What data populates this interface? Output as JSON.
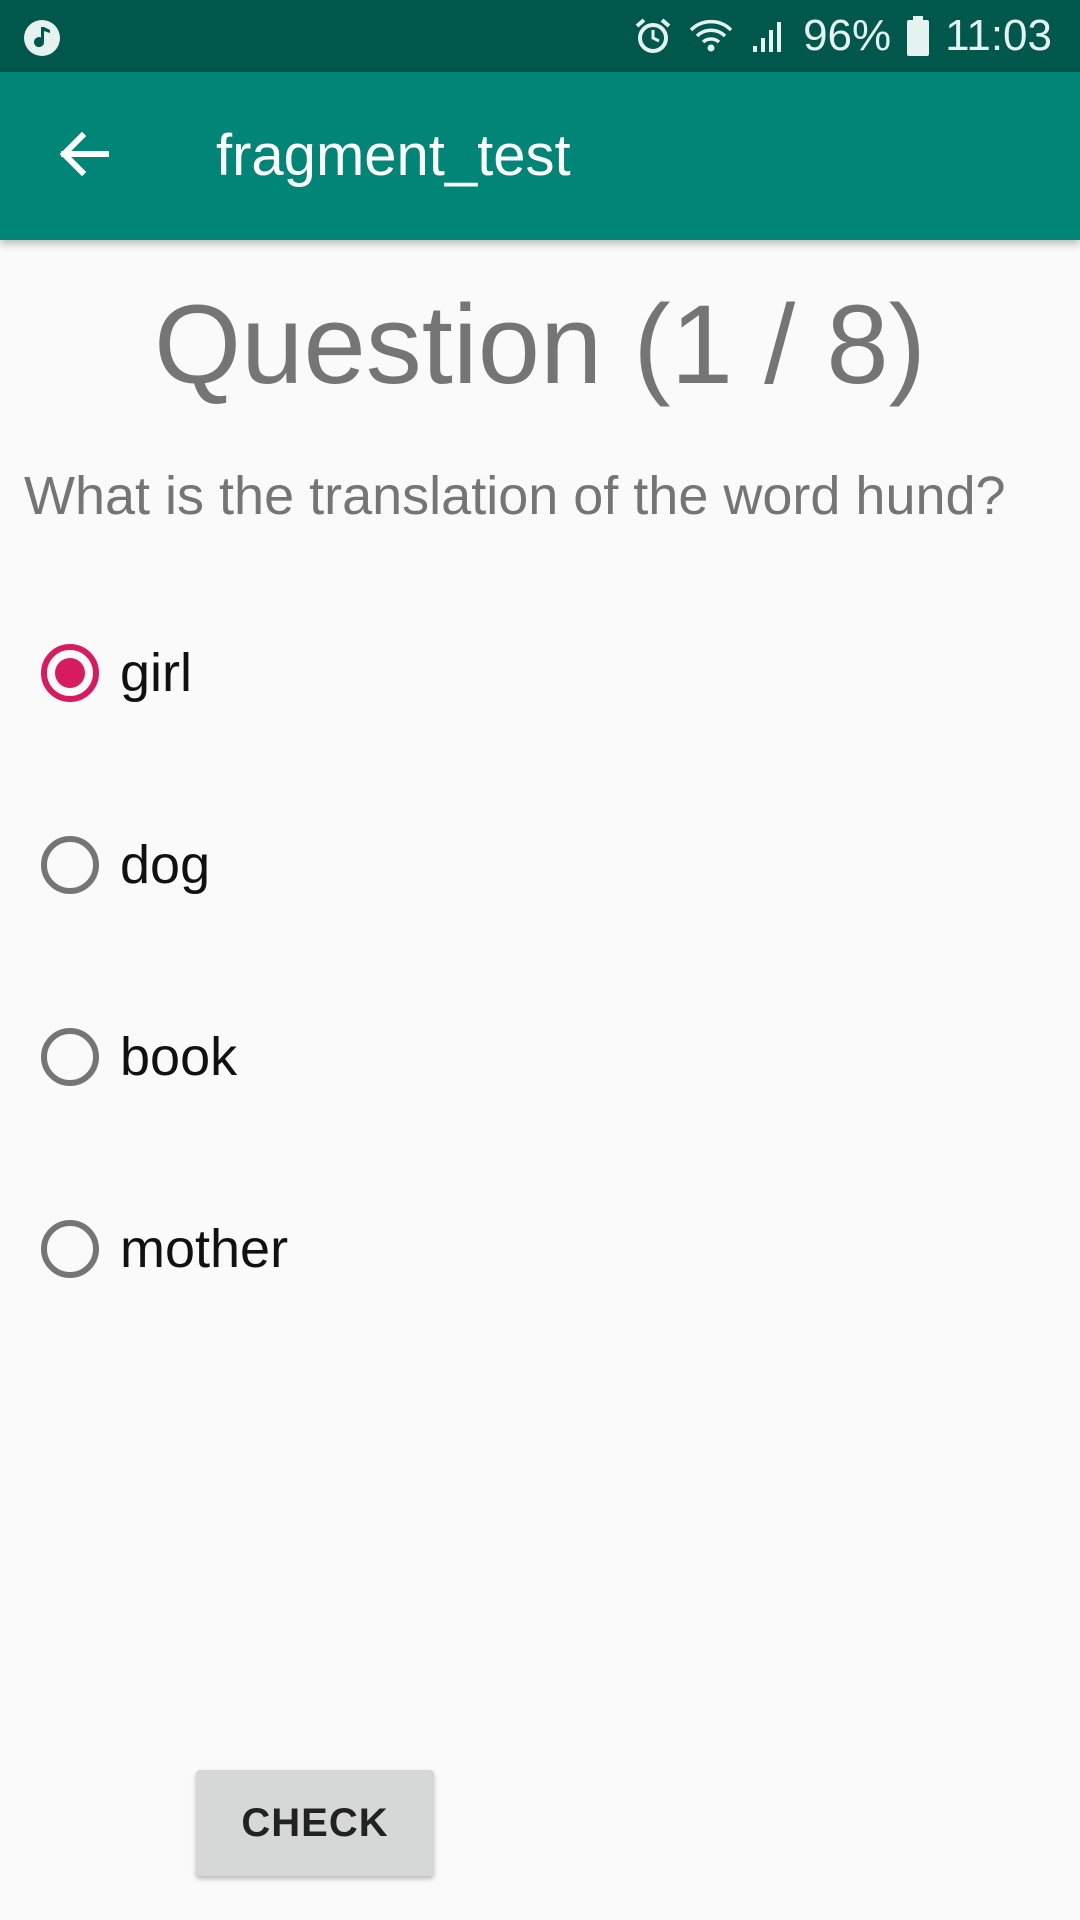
{
  "status_bar": {
    "battery": "96%",
    "time": "11:03",
    "icons": [
      "music-note-icon",
      "alarm-icon",
      "wifi-icon",
      "signal-icon",
      "battery-icon"
    ]
  },
  "app_bar": {
    "title": "fragment_test",
    "back_icon": "arrow-back-icon",
    "color": "#008577"
  },
  "quiz": {
    "heading": "Question (1 / 8)",
    "question": "What is the translation of the word hund?",
    "options": [
      {
        "label": "girl",
        "selected": true
      },
      {
        "label": "dog",
        "selected": false
      },
      {
        "label": "book",
        "selected": false
      },
      {
        "label": "mother",
        "selected": false
      }
    ],
    "accent_color": "#d81b60"
  },
  "actions": {
    "check_label": "CHECK"
  }
}
